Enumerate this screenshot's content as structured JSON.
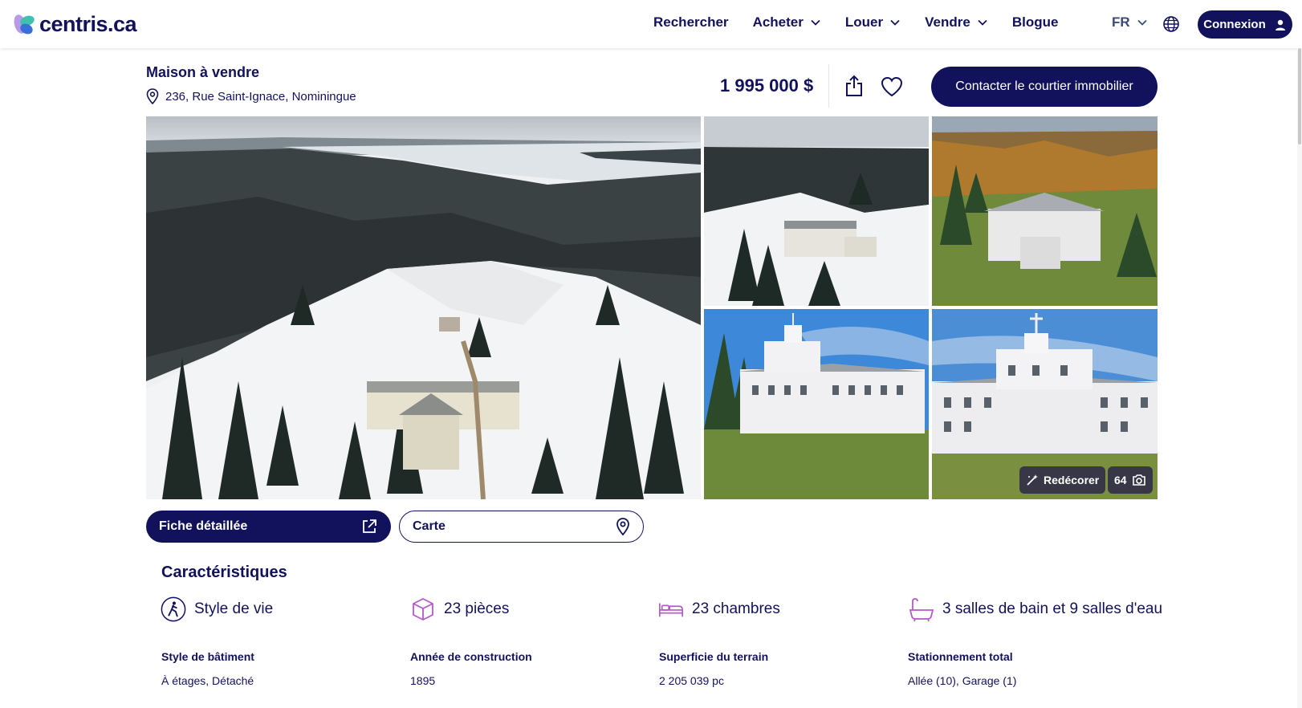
{
  "brand": {
    "logo_text": "centris.ca",
    "primary_color": "#12125c"
  },
  "nav": {
    "items": [
      {
        "label": "Rechercher",
        "has_dropdown": false
      },
      {
        "label": "Acheter",
        "has_dropdown": true
      },
      {
        "label": "Louer",
        "has_dropdown": true
      },
      {
        "label": "Vendre",
        "has_dropdown": true
      },
      {
        "label": "Blogue",
        "has_dropdown": false
      }
    ],
    "language": "FR",
    "login_label": "Connexion"
  },
  "listing": {
    "title": "Maison à vendre",
    "address": "236, Rue Saint-Ignace, Nominingue",
    "price": "1 995 000 $",
    "contact_label": "Contacter le courtier immobilier"
  },
  "photos": {
    "redecor_label": "Redécorer",
    "count": "64"
  },
  "actions": {
    "fiche_label": "Fiche détaillée",
    "carte_label": "Carte"
  },
  "characteristics": {
    "title": "Caractéristiques",
    "features": [
      {
        "icon": "walking-person-icon",
        "label": "Style de vie"
      },
      {
        "icon": "cube-icon",
        "label": "23 pièces"
      },
      {
        "icon": "bed-icon",
        "label": "23 chambres"
      },
      {
        "icon": "bathtub-icon",
        "label": "3 salles de bain et 9 salles d'eau"
      }
    ],
    "details": [
      {
        "label": "Style de bâtiment",
        "value": "À étages, Détaché"
      },
      {
        "label": "Année de construction",
        "value": "1895"
      },
      {
        "label": "Superficie du terrain",
        "value": "2 205 039 pc"
      },
      {
        "label": "Stationnement total",
        "value": "Allée (10), Garage (1)"
      }
    ]
  }
}
